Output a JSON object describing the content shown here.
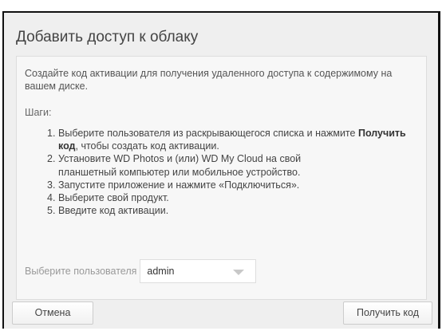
{
  "dialog": {
    "title": "Добавить доступ к облаку",
    "intro": "Создайте код активации для получения удаленного доступа к содержимому на вашем диске.",
    "steps_label": "Шаги:",
    "steps": [
      {
        "num": "1.",
        "before": "Выберите пользователя из раскрывающегося списка и нажмите ",
        "bold": "Получить код",
        "after": ", чтобы создать код активации."
      },
      {
        "num": "2.",
        "before": "Установите WD Photos и (или) WD My Cloud на свой планшетный компьютер или мобильное устройство.",
        "bold": "",
        "after": ""
      },
      {
        "num": "3.",
        "before": "Запустите приложение и нажмите «Подключиться».",
        "bold": "",
        "after": ""
      },
      {
        "num": "4.",
        "before": "Выберите свой продукт.",
        "bold": "",
        "after": ""
      },
      {
        "num": "5.",
        "before": "Введите код активации.",
        "bold": "",
        "after": ""
      }
    ],
    "user_label": "Выберите пользователя",
    "user_select": {
      "value": "admin",
      "icon": "chevron-down-icon"
    },
    "cancel_label": "Отмена",
    "get_code_label": "Получить код"
  }
}
